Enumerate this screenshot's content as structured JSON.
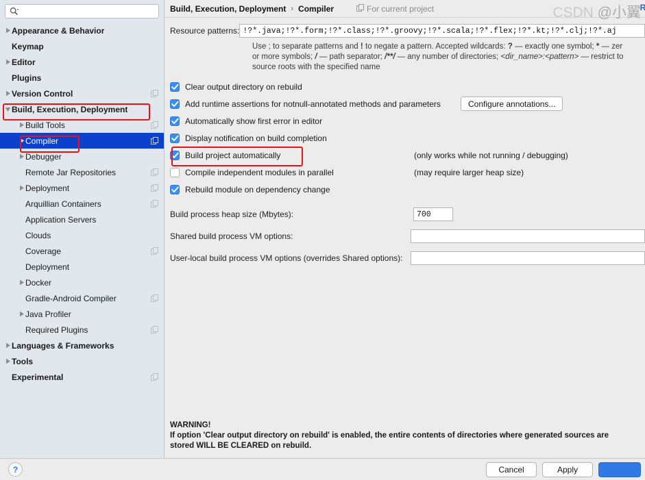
{
  "search": {
    "value": "",
    "placeholder": "",
    "icon": "search-icon"
  },
  "sidebar": {
    "items": [
      {
        "label": "Appearance & Behavior",
        "level": 0,
        "arrow": "collapsed",
        "scope": false,
        "selected": false
      },
      {
        "label": "Keymap",
        "level": 0,
        "arrow": "none",
        "scope": false,
        "selected": false
      },
      {
        "label": "Editor",
        "level": 0,
        "arrow": "collapsed",
        "scope": false,
        "selected": false
      },
      {
        "label": "Plugins",
        "level": 0,
        "arrow": "none",
        "scope": false,
        "selected": false
      },
      {
        "label": "Version Control",
        "level": 0,
        "arrow": "collapsed",
        "scope": true,
        "selected": false
      },
      {
        "label": "Build, Execution, Deployment",
        "level": 0,
        "arrow": "expanded",
        "scope": false,
        "selected": false
      },
      {
        "label": "Build Tools",
        "level": 1,
        "arrow": "collapsed",
        "scope": true,
        "selected": false
      },
      {
        "label": "Compiler",
        "level": 1,
        "arrow": "collapsed",
        "scope": true,
        "selected": true
      },
      {
        "label": "Debugger",
        "level": 1,
        "arrow": "collapsed",
        "scope": false,
        "selected": false
      },
      {
        "label": "Remote Jar Repositories",
        "level": 1,
        "arrow": "none",
        "scope": true,
        "selected": false
      },
      {
        "label": "Deployment",
        "level": 1,
        "arrow": "collapsed",
        "scope": true,
        "selected": false
      },
      {
        "label": "Arquillian Containers",
        "level": 1,
        "arrow": "none",
        "scope": true,
        "selected": false
      },
      {
        "label": "Application Servers",
        "level": 1,
        "arrow": "none",
        "scope": false,
        "selected": false
      },
      {
        "label": "Clouds",
        "level": 1,
        "arrow": "none",
        "scope": false,
        "selected": false
      },
      {
        "label": "Coverage",
        "level": 1,
        "arrow": "none",
        "scope": true,
        "selected": false
      },
      {
        "label": "Deployment",
        "level": 1,
        "arrow": "none",
        "scope": false,
        "selected": false
      },
      {
        "label": "Docker",
        "level": 1,
        "arrow": "collapsed",
        "scope": false,
        "selected": false
      },
      {
        "label": "Gradle-Android Compiler",
        "level": 1,
        "arrow": "none",
        "scope": true,
        "selected": false
      },
      {
        "label": "Java Profiler",
        "level": 1,
        "arrow": "collapsed",
        "scope": false,
        "selected": false
      },
      {
        "label": "Required Plugins",
        "level": 1,
        "arrow": "none",
        "scope": true,
        "selected": false
      },
      {
        "label": "Languages & Frameworks",
        "level": 0,
        "arrow": "collapsed",
        "scope": false,
        "selected": false
      },
      {
        "label": "Tools",
        "level": 0,
        "arrow": "collapsed",
        "scope": false,
        "selected": false
      },
      {
        "label": "Experimental",
        "level": 0,
        "arrow": "none",
        "scope": true,
        "selected": false
      }
    ]
  },
  "breadcrumb": {
    "root": "Build, Execution, Deployment",
    "separator": "›",
    "leaf": "Compiler",
    "project_scope": "For current project",
    "reset": "Re"
  },
  "main": {
    "resource_patterns": {
      "label": "Resource patterns:",
      "value": "!?*.java;!?*.form;!?*.class;!?*.groovy;!?*.scala;!?*.flex;!?*.kt;!?*.clj;!?*.aj"
    },
    "hint": {
      "line1_a": "Use ; to separate patterns and ",
      "line1_b": "!",
      "line1_c": " to negate a pattern. Accepted wildcards: ",
      "line1_d": "?",
      "line1_e": " — exactly one symbol; ",
      "line1_f": "*",
      "line1_g": " — zer",
      "line2_a": "or more symbols; ",
      "line2_b": "/",
      "line2_c": " — path separator; ",
      "line2_d": "/**/",
      "line2_e": " — any number of directories; ",
      "line2_f": "<dir_name>:<pattern>",
      "line2_g": " — restrict to",
      "line3": "source roots with the specified name"
    },
    "checkboxes": [
      {
        "label": "Clear output directory on rebuild",
        "checked": true,
        "note": ""
      },
      {
        "label": "Add runtime assertions for notnull-annotated methods and parameters",
        "checked": true,
        "note": ""
      },
      {
        "label": "Automatically show first error in editor",
        "checked": true,
        "note": ""
      },
      {
        "label": "Display notification on build completion",
        "checked": true,
        "note": ""
      },
      {
        "label": "Build project automatically",
        "checked": true,
        "note": "(only works while not running / debugging)"
      },
      {
        "label": "Compile independent modules in parallel",
        "checked": false,
        "note": "(may require larger heap size)"
      },
      {
        "label": "Rebuild module on dependency change",
        "checked": true,
        "note": ""
      }
    ],
    "configure_annotations_button": "Configure annotations...",
    "heap": {
      "label": "Build process heap size (Mbytes):",
      "value": "700"
    },
    "shared_vm": {
      "label": "Shared build process VM options:",
      "value": ""
    },
    "user_vm": {
      "label": "User-local build process VM options (overrides Shared options):",
      "value": ""
    },
    "warning": {
      "title": "WARNING!",
      "line1": "If option 'Clear output directory on rebuild' is enabled, the entire contents of directories where generated sources are",
      "line2": "stored WILL BE CLEARED on rebuild."
    }
  },
  "footer": {
    "help": "?",
    "cancel": "Cancel",
    "apply": "Apply",
    "ok": ""
  },
  "watermark": {
    "text1": "CSDN ",
    "text2": "@小翼"
  },
  "colors": {
    "selection_blue": "#0b41cd",
    "checkbox_blue": "#3a8ef0",
    "annotation_red": "#ee1111",
    "link_blue": "#2f62c4",
    "sidebar_bg": "#e2e6ed",
    "pane_bg": "#ececec"
  }
}
